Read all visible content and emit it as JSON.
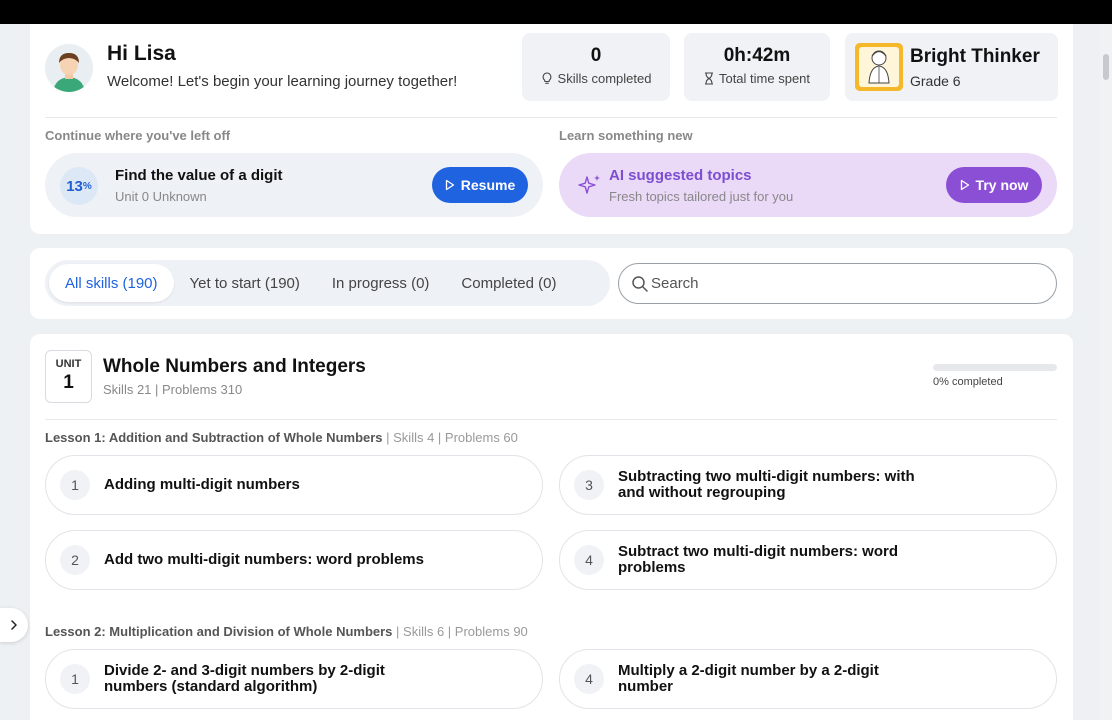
{
  "greeting": "Hi Lisa",
  "welcome": "Welcome! Let's begin your learning journey together!",
  "stats": {
    "skills_completed_value": "0",
    "skills_completed_label": "Skills completed",
    "time_value": "0h:42m",
    "time_label": "Total time spent"
  },
  "profile": {
    "name": "Bright Thinker",
    "grade": "Grade 6",
    "badge_text": "BrightThinker"
  },
  "continue": {
    "section_label": "Continue where you've left off",
    "percent": "13",
    "percent_sign": "%",
    "title": "Find the value of a digit",
    "subtitle": "Unit 0 Unknown",
    "button": "Resume"
  },
  "learn_new": {
    "section_label": "Learn something new",
    "title": "AI suggested topics",
    "subtitle": "Fresh topics tailored just for you",
    "button": "Try now"
  },
  "tabs": [
    {
      "label": "All skills (190)"
    },
    {
      "label": "Yet to start (190)"
    },
    {
      "label": "In progress (0)"
    },
    {
      "label": "Completed (0)"
    }
  ],
  "search": {
    "placeholder": "Search",
    "value": ""
  },
  "unit": {
    "label": "UNIT",
    "number": "1",
    "title": "Whole Numbers and Integers",
    "meta": "Skills 21 | Problems 310",
    "progress_fraction": 0,
    "progress_label": "0% completed"
  },
  "lessons": [
    {
      "title": "Lesson 1: Addition and Subtraction of Whole Numbers",
      "meta": " | Skills 4 | Problems 60",
      "skills": [
        {
          "num": "1",
          "name": "Adding multi-digit numbers"
        },
        {
          "num": "3",
          "name": "Subtracting two multi-digit numbers: with and without regrouping"
        },
        {
          "num": "2",
          "name": "Add two multi-digit numbers: word problems"
        },
        {
          "num": "4",
          "name": "Subtract two multi-digit numbers: word problems"
        }
      ]
    },
    {
      "title": "Lesson 2: Multiplication and Division of Whole Numbers",
      "meta": " | Skills 6 | Problems 90",
      "skills": [
        {
          "num": "1",
          "name": "Divide 2- and 3-digit numbers by 2-digit numbers (standard algorithm)"
        },
        {
          "num": "4",
          "name": "Multiply a 2-digit number by a 2-digit number"
        }
      ]
    }
  ],
  "colors": {
    "primary": "#1f63e0",
    "ai_accent": "#8b4fd6",
    "ai_background": "#ead9f7"
  }
}
